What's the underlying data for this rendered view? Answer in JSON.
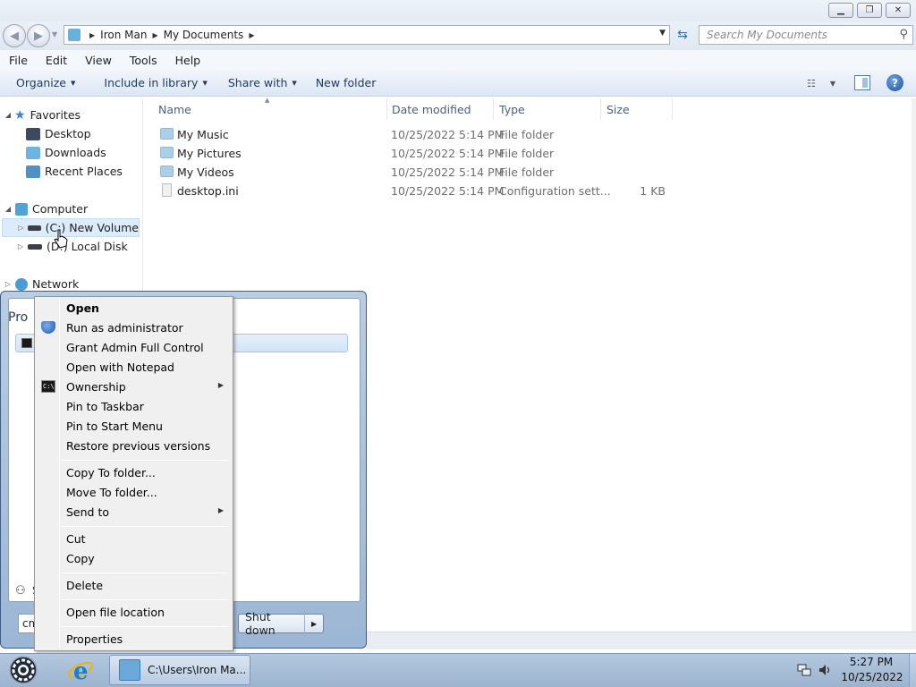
{
  "window": {
    "address_crumbs": [
      "Iron Man",
      "My Documents"
    ],
    "search_placeholder": "Search My Documents"
  },
  "menubar": [
    "File",
    "Edit",
    "View",
    "Tools",
    "Help"
  ],
  "commandbar": {
    "organize": "Organize",
    "include_in_library": "Include in library",
    "share_with": "Share with",
    "new_folder": "New folder"
  },
  "navpane": {
    "favorites": "Favorites",
    "desktop": "Desktop",
    "downloads": "Downloads",
    "recent_places": "Recent Places",
    "computer": "Computer",
    "drive_c": "(C:) New Volume",
    "drive_d": "(D:) Local Disk",
    "network": "Network"
  },
  "filelist": {
    "columns": [
      "Name",
      "Date modified",
      "Type",
      "Size"
    ],
    "rows": [
      {
        "name": "My Music",
        "date": "10/25/2022 5:14 PM",
        "type": "File folder",
        "size": "",
        "kind": "folder"
      },
      {
        "name": "My Pictures",
        "date": "10/25/2022 5:14 PM",
        "type": "File folder",
        "size": "",
        "kind": "folder"
      },
      {
        "name": "My Videos",
        "date": "10/25/2022 5:14 PM",
        "type": "File folder",
        "size": "",
        "kind": "folder"
      },
      {
        "name": "desktop.ini",
        "date": "10/25/2022 5:14 PM",
        "type": "Configuration sett...",
        "size": "1 KB",
        "kind": "file"
      }
    ]
  },
  "startmenu": {
    "programs_label": "Pro",
    "search_fragment": "S",
    "search_value": "cm",
    "shutdown": "Shut down"
  },
  "context_menu": {
    "open": "Open",
    "run_as_admin": "Run as administrator",
    "grant_admin": "Grant Admin Full Control",
    "open_notepad": "Open with Notepad",
    "ownership": "Ownership",
    "pin_taskbar": "Pin to Taskbar",
    "pin_start": "Pin to Start Menu",
    "restore_prev": "Restore previous versions",
    "copy_to": "Copy To folder...",
    "move_to": "Move To folder...",
    "send_to": "Send to",
    "cut": "Cut",
    "copy": "Copy",
    "delete": "Delete",
    "open_location": "Open file location",
    "properties": "Properties"
  },
  "taskbar": {
    "explorer_task": "C:\\Users\\Iron Ma...",
    "time": "5:27 PM",
    "date": "10/25/2022"
  },
  "icons": {
    "back": "back-arrow-icon",
    "forward": "forward-arrow-icon",
    "refresh": "refresh-icon",
    "search": "magnifier-icon",
    "help": "help-icon",
    "start": "start-orb-icon",
    "ie": "internet-explorer-icon"
  }
}
